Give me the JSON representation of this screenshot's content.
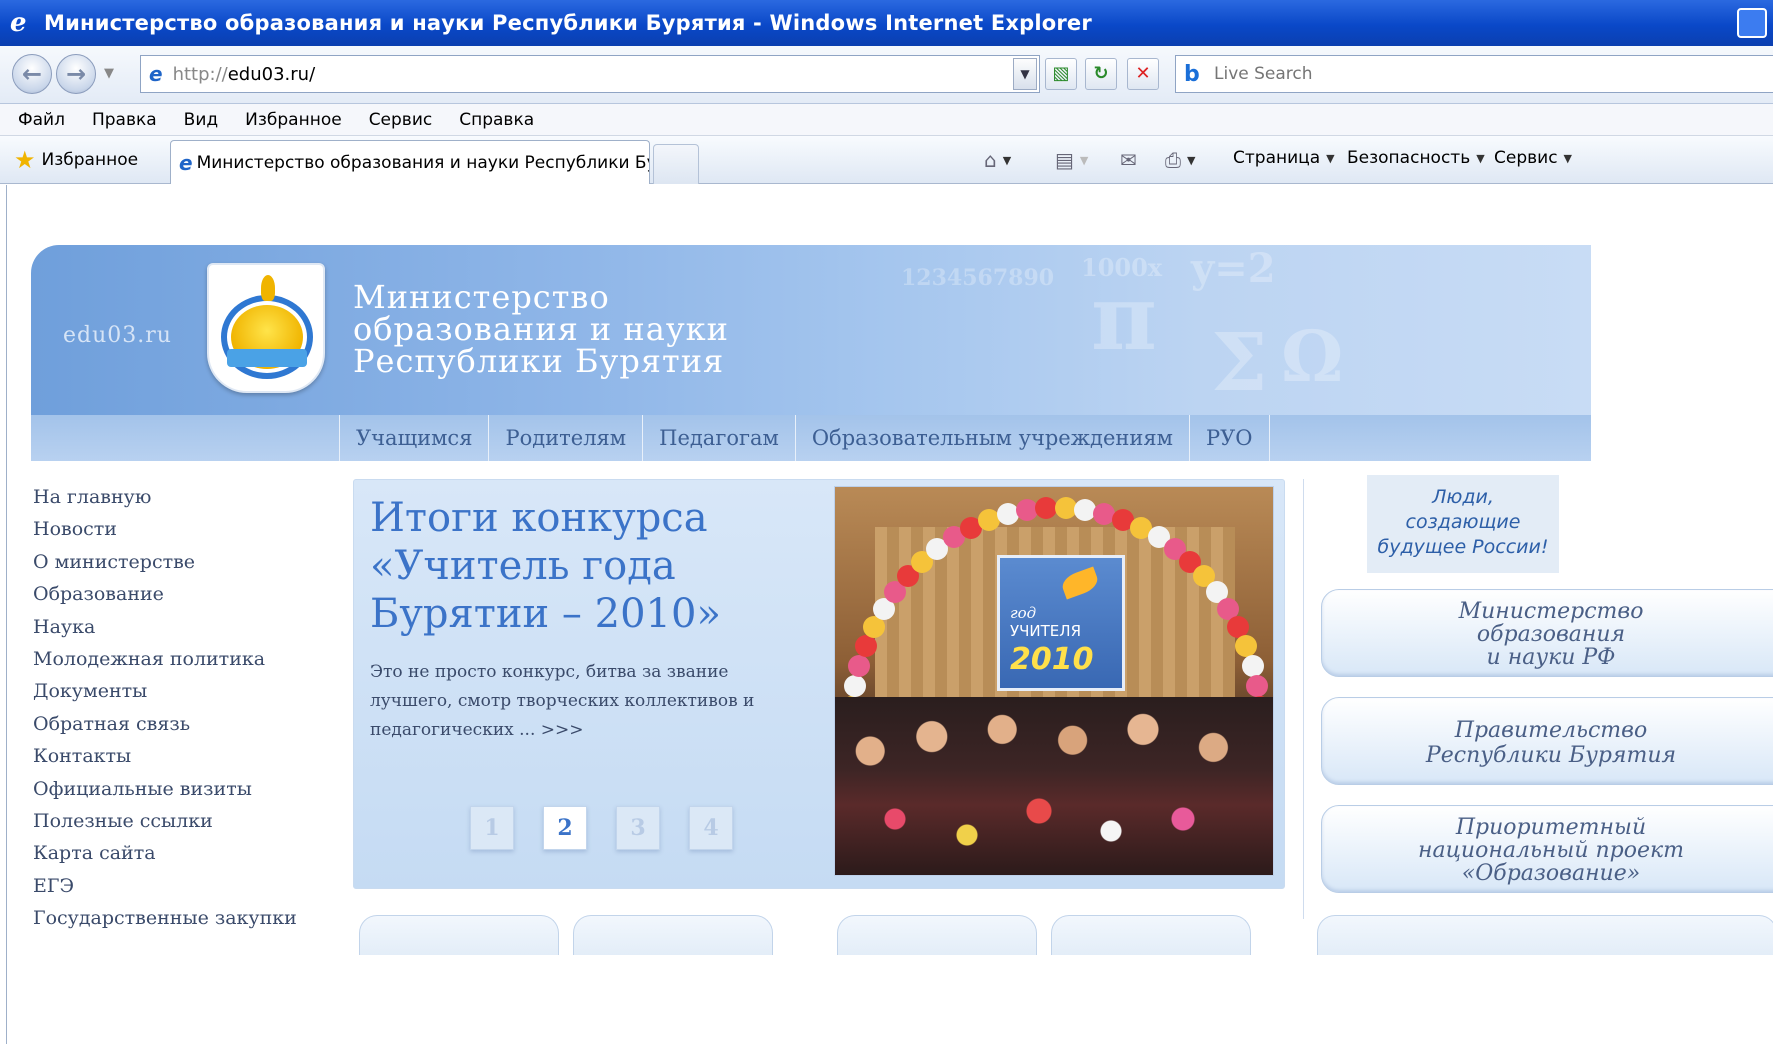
{
  "window": {
    "title": "Министерство образования и науки Республики Бурятия - Windows Internet Explorer"
  },
  "address": {
    "url_prefix": "http://",
    "url_host": "edu03.ru/",
    "search_placeholder": "Live Search"
  },
  "menu": [
    "Файл",
    "Правка",
    "Вид",
    "Избранное",
    "Сервис",
    "Справка"
  ],
  "favorites": {
    "label": "Избранное",
    "tab_title": "Министерство образования и науки Республики Бу..."
  },
  "commands": {
    "page": "Страница",
    "security": "Безопасность",
    "tools": "Сервис"
  },
  "banner": {
    "site_name": "edu03.ru",
    "title_line1": "Министерство",
    "title_line2": "образования и науки",
    "title_line3": "Республики Бурятия",
    "decor": [
      "1234567890",
      "π",
      "Σ",
      "Ω",
      "1000x",
      "y=2"
    ]
  },
  "topnav": [
    "Учащимся",
    "Родителям",
    "Педагогам",
    "Образовательным учреждениям",
    "РУО"
  ],
  "leftmenu": [
    "На главную",
    "Новости",
    "О министерстве",
    "Образование",
    "Наука",
    "Молодежная политика",
    "Документы",
    "Обратная связь",
    "Контакты",
    "Официальные визиты",
    "Полезные ссылки",
    "Карта сайта",
    "ЕГЭ",
    "Государственные закупки"
  ],
  "feature": {
    "title": "Итоги конкурса «Учитель года Бурятии – 2010»",
    "text": "Это не просто конкурс, битва за звание лучшего, смотр творческих коллективов и педагогических ... >>>",
    "pages": [
      "1",
      "2",
      "3",
      "4"
    ],
    "active_page": "2",
    "poster_line1": "год",
    "poster_line2": "УЧИТЕЛЯ",
    "poster_year": "2010"
  },
  "right": {
    "people_line1": "Люди,",
    "people_line2": "создающие",
    "people_line3": "будущее России!",
    "box1_line1": "Министерство",
    "box1_line2": "образования",
    "box1_line3": "и науки РФ",
    "box2_line1": "Правительство",
    "box2_line2": "Республики Бурятия",
    "box3_line1": "Приоритетный",
    "box3_line2": "национальный проект",
    "box3_line3": "«Образование»"
  },
  "colors": {
    "titlebar": "#0a48c8",
    "link_text": "#3a4a6a",
    "accent": "#3b73c8",
    "banner": "#8fb6e8"
  }
}
